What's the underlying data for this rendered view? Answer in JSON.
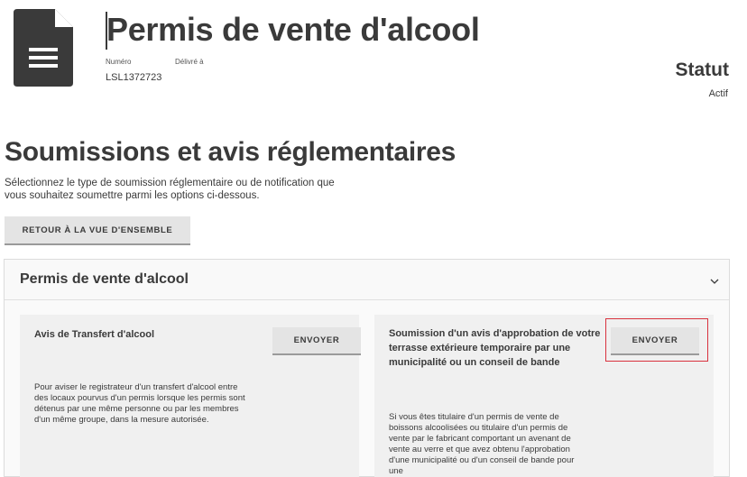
{
  "header": {
    "icon": "document-icon",
    "title": "Permis de vente d'alcool",
    "number_label": "Numéro",
    "delivered_label": "Délivré à",
    "number_value": "LSL1372723",
    "status_label": "Statut",
    "status_value": "Actif"
  },
  "section": {
    "title": "Soumissions et avis réglementaires",
    "description": "Sélectionnez le type de soumission réglementaire ou de notification que vous souhaitez soumettre parmi les options ci-dessous.",
    "back_button": "RETOUR À LA VUE D'ENSEMBLE"
  },
  "accordion": {
    "title": "Permis de vente d'alcool",
    "icon": "chevron-down-icon",
    "cards": [
      {
        "title": "Avis de Transfert d'alcool",
        "button": "ENVOYER",
        "description": "Pour aviser le registrateur d'un transfert d'alcool entre des locaux pourvus d'un permis lorsque les permis sont détenus par une même personne ou par les membres d'un même groupe, dans la mesure autorisée."
      },
      {
        "title": "Soumission d'un avis d'approbation de votre terrasse extérieure temporaire par une municipalité ou un conseil de bande",
        "button": "ENVOYER",
        "description": "Si vous êtes titulaire d'un permis de vente de boissons alcoolisées ou titulaire d'un permis de vente par le fabricant comportant un avenant de vente au verre et que avez obtenu l'approbation d'une municipalité ou d'un conseil de bande pour une"
      }
    ]
  },
  "colors": {
    "text": "#3a3a3a",
    "button_bg": "#e4e4e4",
    "highlight": "#d9323e"
  }
}
